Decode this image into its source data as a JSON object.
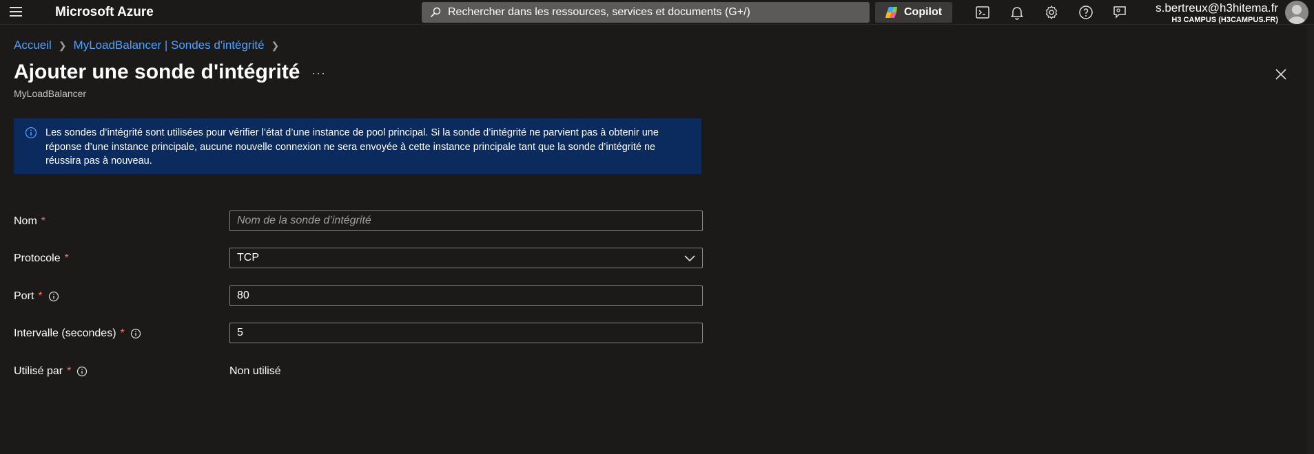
{
  "topbar": {
    "brand": "Microsoft Azure",
    "search_placeholder": "Rechercher dans les ressources, services et documents (G+/)",
    "copilot_label": "Copilot",
    "user_email": "s.bertreux@h3hitema.fr",
    "user_org": "H3 CAMPUS (H3CAMPUS.FR)"
  },
  "breadcrumb": {
    "items": [
      "Accueil",
      "MyLoadBalancer | Sondes d'intégrité"
    ]
  },
  "page": {
    "title": "Ajouter une sonde d'intégrité",
    "more": "···",
    "subtitle": "MyLoadBalancer"
  },
  "banner": {
    "text": "Les sondes d’intégrité sont utilisées pour vérifier l’état d’une instance de pool principal. Si la sonde d’intégrité ne parvient pas à obtenir une réponse d’une instance principale, aucune nouvelle connexion ne sera envoyée à cette instance principale tant que la sonde d’intégrité ne réussira pas à nouveau."
  },
  "form": {
    "name": {
      "label": "Nom",
      "required": "*",
      "placeholder": "Nom de la sonde d’intégrité",
      "value": ""
    },
    "protocol": {
      "label": "Protocole",
      "required": "*",
      "value": "TCP"
    },
    "port": {
      "label": "Port",
      "required": "*",
      "value": "80"
    },
    "interval": {
      "label": "Intervalle (secondes)",
      "required": "*",
      "value": "5"
    },
    "used_by": {
      "label": "Utilisé par",
      "required": "*",
      "value": "Non utilisé"
    }
  },
  "colors": {
    "background": "#1b1a19",
    "banner": "#0b2a5e",
    "link": "#4fa0ff",
    "required": "#ff6a5f"
  },
  "icons": {
    "menu": "hamburger-icon",
    "search": "search-icon",
    "copilot": "copilot-icon",
    "cloud_shell": "cloud-shell-icon",
    "notifications": "bell-icon",
    "settings": "gear-icon",
    "help": "help-icon",
    "feedback": "feedback-icon",
    "close": "close-icon",
    "info": "info-icon",
    "dropdown": "chevron-down-icon"
  }
}
